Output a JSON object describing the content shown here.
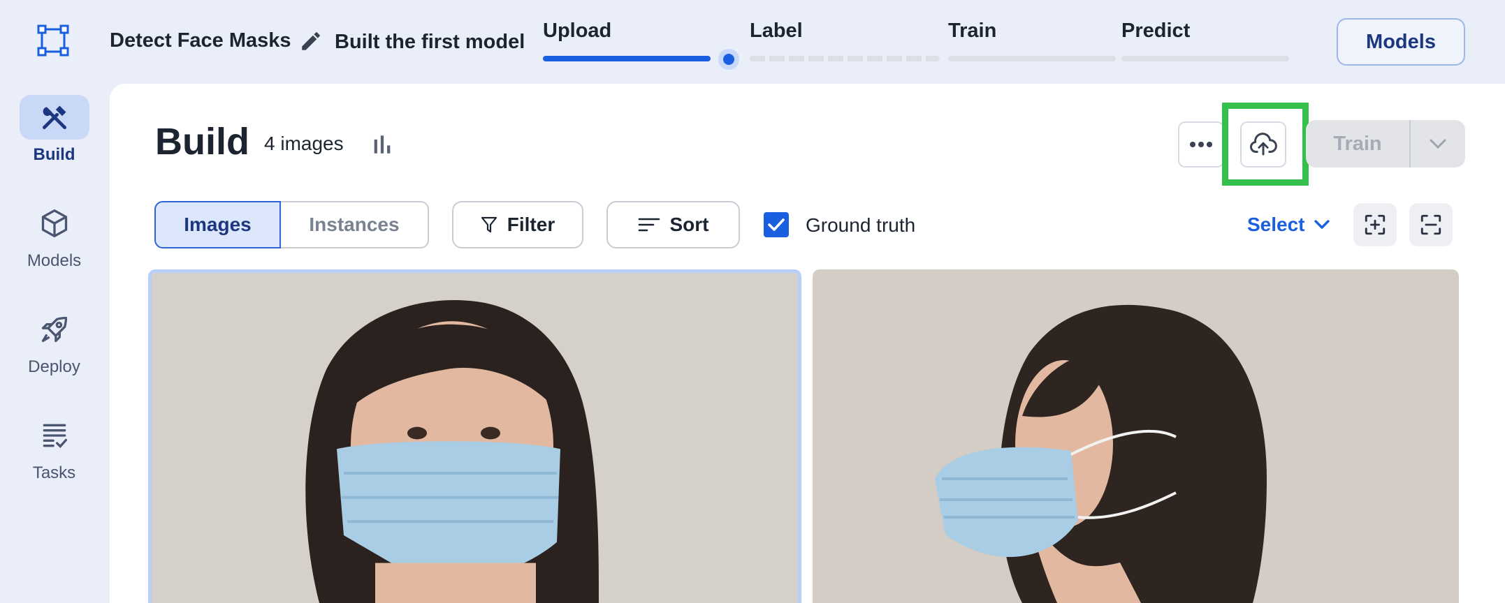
{
  "header": {
    "project_name": "Detect Face Masks",
    "model_name": "Built the first model",
    "steps": [
      {
        "label": "Upload",
        "state": "done"
      },
      {
        "label": "Label",
        "state": "current"
      },
      {
        "label": "Train",
        "state": "todo"
      },
      {
        "label": "Predict",
        "state": "todo"
      }
    ],
    "models_button": "Models"
  },
  "sidebar": {
    "items": [
      {
        "label": "Build",
        "icon": "hammer-wrench-icon",
        "active": true
      },
      {
        "label": "Models",
        "icon": "cube-icon",
        "active": false
      },
      {
        "label": "Deploy",
        "icon": "rocket-icon",
        "active": false
      },
      {
        "label": "Tasks",
        "icon": "checklist-icon",
        "active": false
      }
    ]
  },
  "main": {
    "title": "Build",
    "image_count": "4 images",
    "train_button": "Train",
    "view_tabs": [
      "Images",
      "Instances"
    ],
    "filter_label": "Filter",
    "sort_label": "Sort",
    "ground_truth_label": "Ground truth",
    "ground_truth_checked": true,
    "select_label": "Select"
  },
  "colors": {
    "accent": "#1a5fe0",
    "highlight": "#34c04a",
    "background": "#e9eef9"
  }
}
